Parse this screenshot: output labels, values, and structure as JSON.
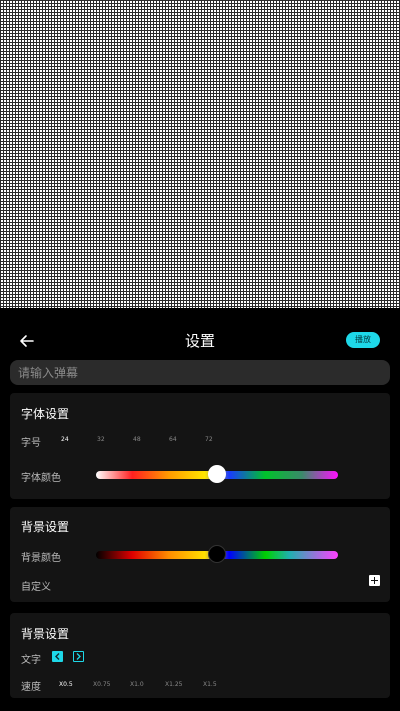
{
  "header": {
    "title": "设置",
    "play_label": "播放"
  },
  "danmaku_input": {
    "placeholder": "请输入弹幕",
    "value": ""
  },
  "font_settings": {
    "title": "字体设置",
    "size_label": "字号",
    "sizes": [
      "24",
      "32",
      "48",
      "64",
      "72"
    ],
    "selected_size": "24",
    "color_label": "字体颜色",
    "color_position": 0.5
  },
  "background_settings": {
    "title": "背景设置",
    "color_label": "背景颜色",
    "color_position": 0.5,
    "custom_label": "自定义"
  },
  "scroll_settings": {
    "title": "背景设置",
    "text_label": "文字",
    "speed_label": "速度",
    "speeds": [
      "X0.5",
      "X0.75",
      "X1.0",
      "X1.25",
      "X1.5"
    ],
    "selected_speed": "X0.5"
  },
  "colors": {
    "accent": "#1ed8e8",
    "card_bg": "#141414",
    "input_bg": "#2b2b2b"
  },
  "icons": {
    "back": "back-arrow-icon",
    "add": "plus-icon",
    "left": "chevron-left-icon",
    "right": "chevron-right-icon"
  }
}
